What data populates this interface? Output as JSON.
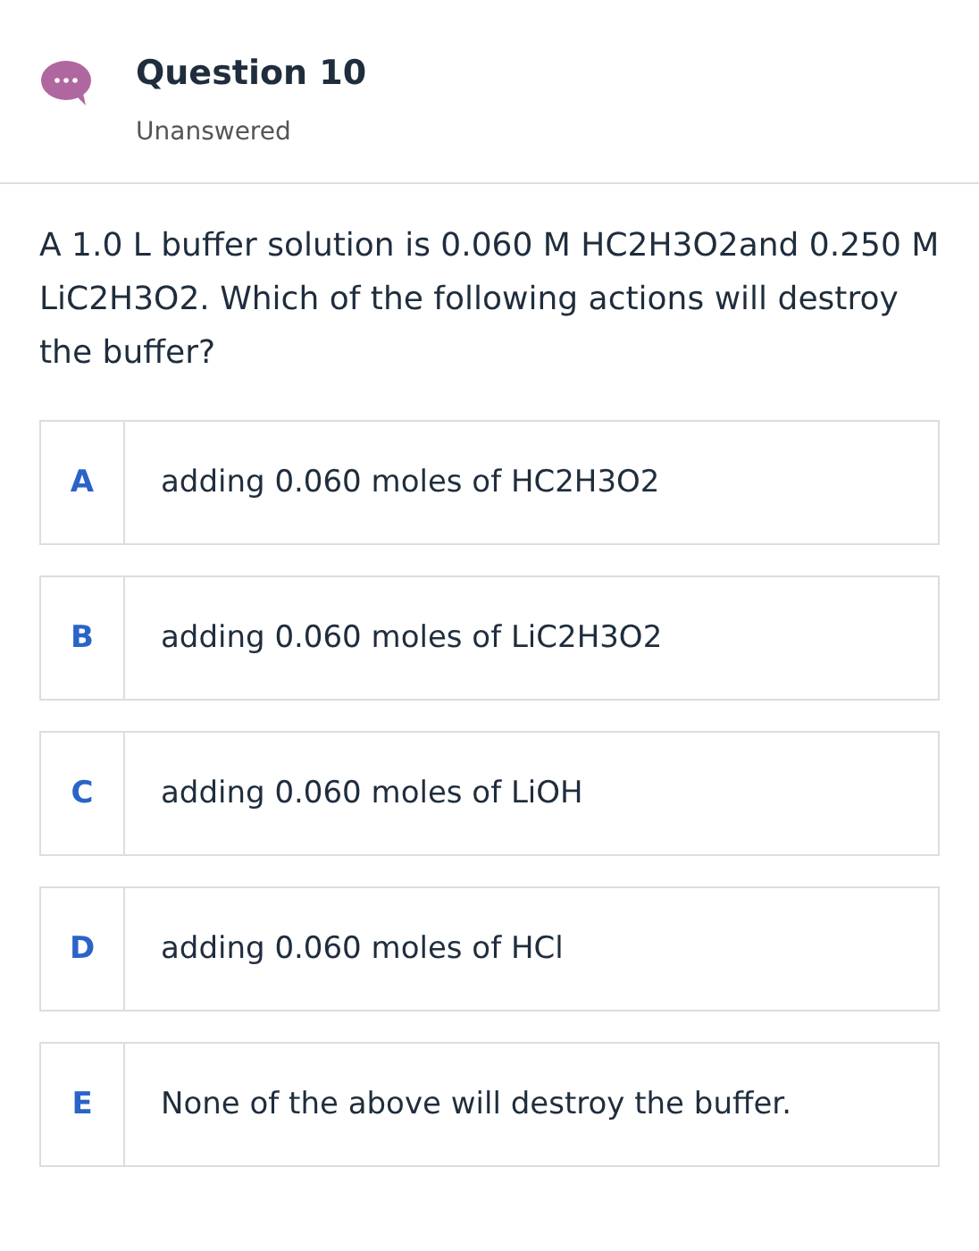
{
  "header": {
    "title": "Question 10",
    "status": "Unanswered"
  },
  "question": "A 1.0 L buffer solution is 0.060 M HC2H3O2and 0.250 M LiC2H3O2. Which of the following actions will destroy the buffer?",
  "options": [
    {
      "letter": "A",
      "text": "adding 0.060 moles of HC2H3O2",
      "selected": false
    },
    {
      "letter": "B",
      "text": "adding 0.060 moles of LiC2H3O2",
      "selected": false
    },
    {
      "letter": "C",
      "text": "adding 0.060 moles of LiOH",
      "selected": false
    },
    {
      "letter": "D",
      "text": "adding 0.060 moles of HCl",
      "selected": false
    },
    {
      "letter": "E",
      "text": "None of the above will destroy the buffer.",
      "selected": false
    }
  ]
}
